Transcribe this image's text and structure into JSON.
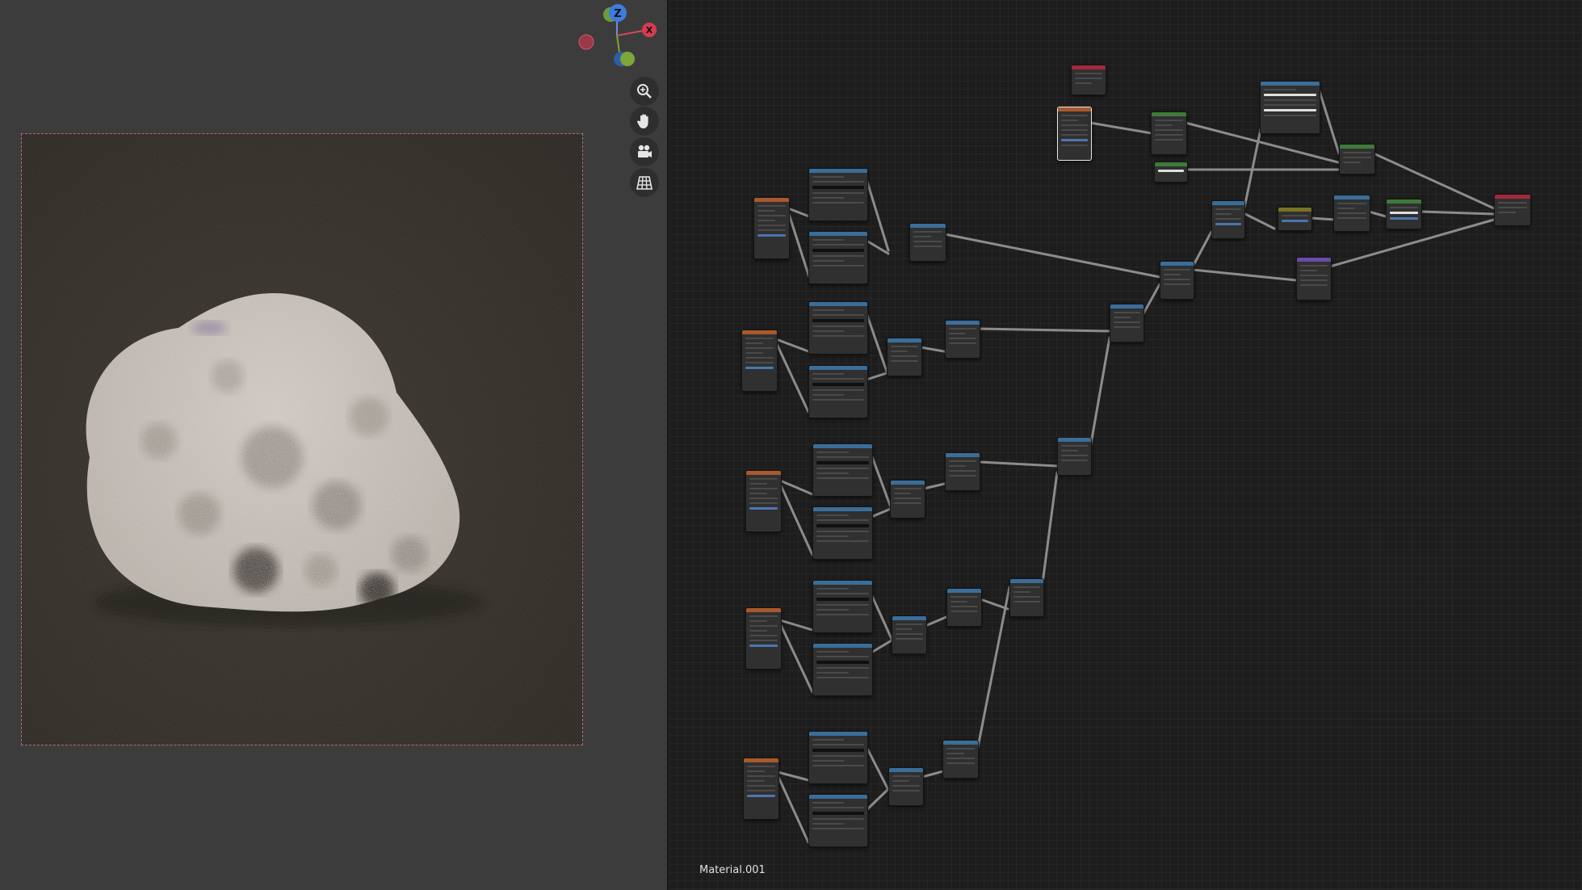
{
  "viewport": {
    "gizmo": {
      "z_label": "Z",
      "x_label": "X"
    },
    "tools": [
      {
        "name": "zoom-icon"
      },
      {
        "name": "hand-pan-icon"
      },
      {
        "name": "camera-icon"
      },
      {
        "name": "grid-ortho-icon"
      }
    ]
  },
  "node_editor": {
    "material_name": "Material.001"
  }
}
